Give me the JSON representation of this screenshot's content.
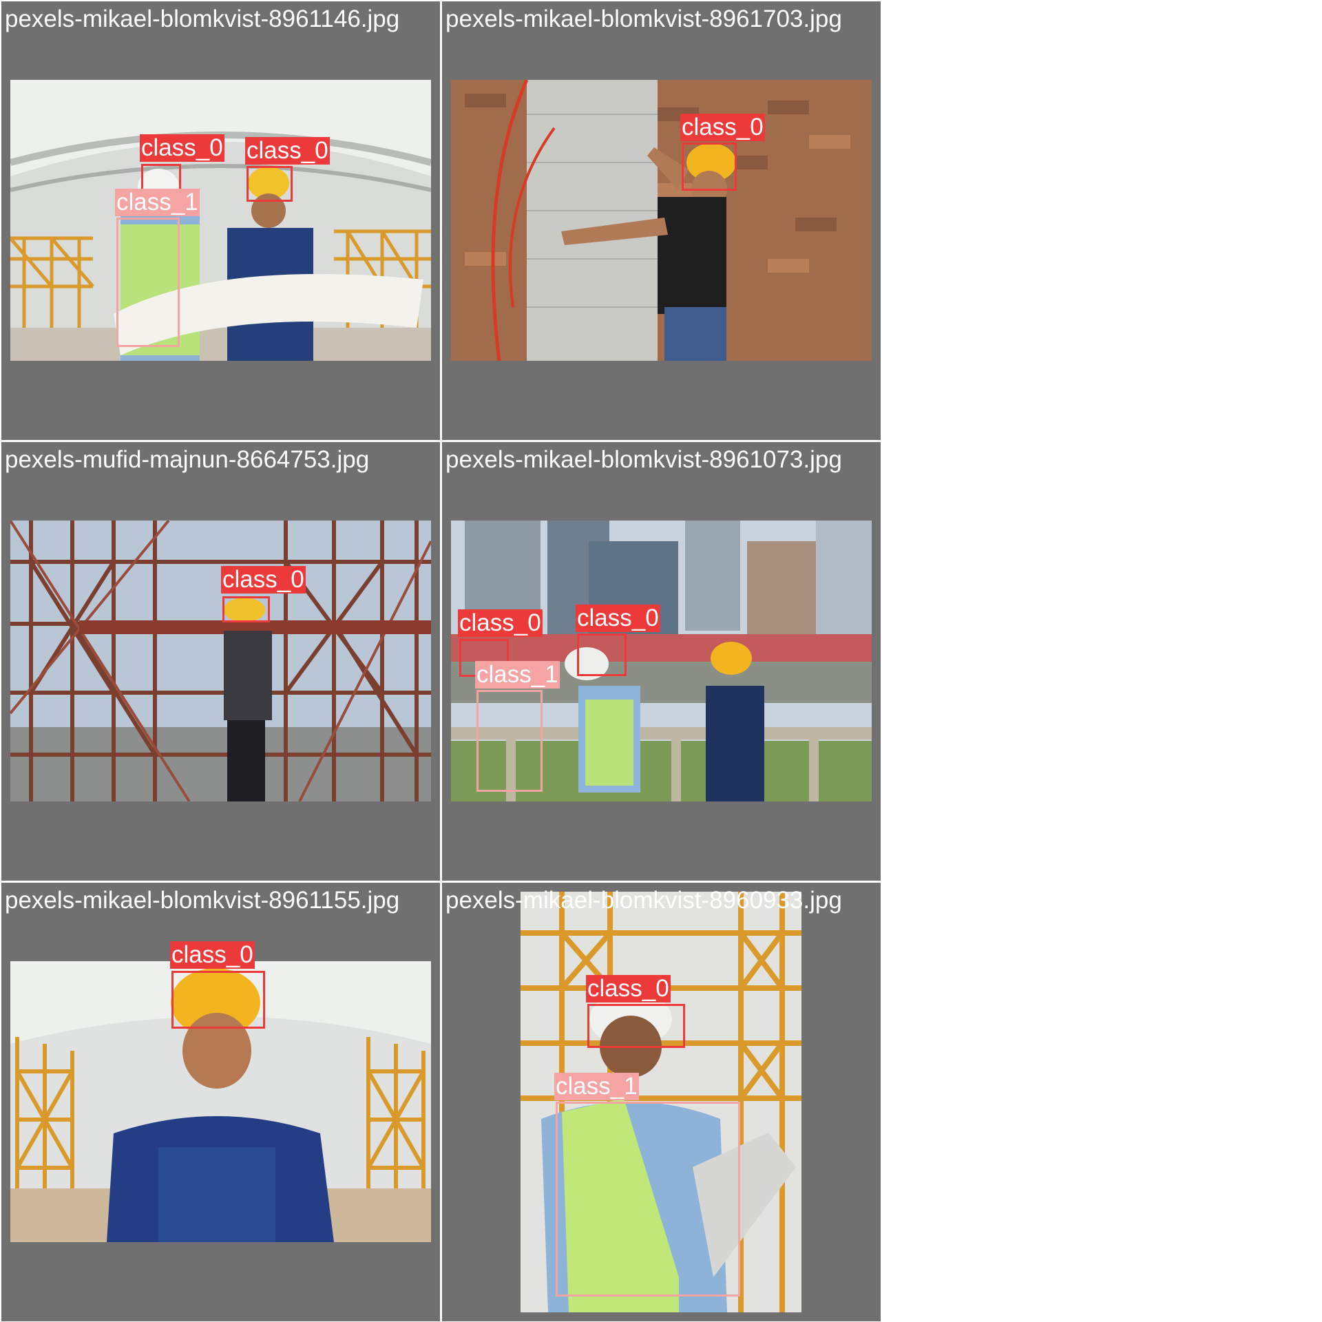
{
  "colors": {
    "tile_bg": "#707070",
    "class_0": "#ec3a3a",
    "class_1": "#f5a3a3",
    "title_text": "#ffffff"
  },
  "tiles": [
    {
      "title": "pexels-mikael-blomkvist-8961146.jpg",
      "detections": [
        {
          "label": "class_0"
        },
        {
          "label": "class_0"
        },
        {
          "label": "class_1"
        }
      ]
    },
    {
      "title": "pexels-mikael-blomkvist-8961703.jpg",
      "detections": [
        {
          "label": "class_0"
        }
      ]
    },
    {
      "title": "pexels-mufid-majnun-8664753.jpg",
      "detections": [
        {
          "label": "class_0"
        }
      ]
    },
    {
      "title": "pexels-mikael-blomkvist-8961073.jpg",
      "detections": [
        {
          "label": "class_0"
        },
        {
          "label": "class_0"
        },
        {
          "label": "class_1"
        }
      ]
    },
    {
      "title": "pexels-mikael-blomkvist-8961155.jpg",
      "detections": [
        {
          "label": "class_0"
        }
      ]
    },
    {
      "title": "pexels-mikael-blomkvist-8960933.jpg",
      "detections": [
        {
          "label": "class_0"
        },
        {
          "label": "class_1"
        }
      ]
    }
  ]
}
